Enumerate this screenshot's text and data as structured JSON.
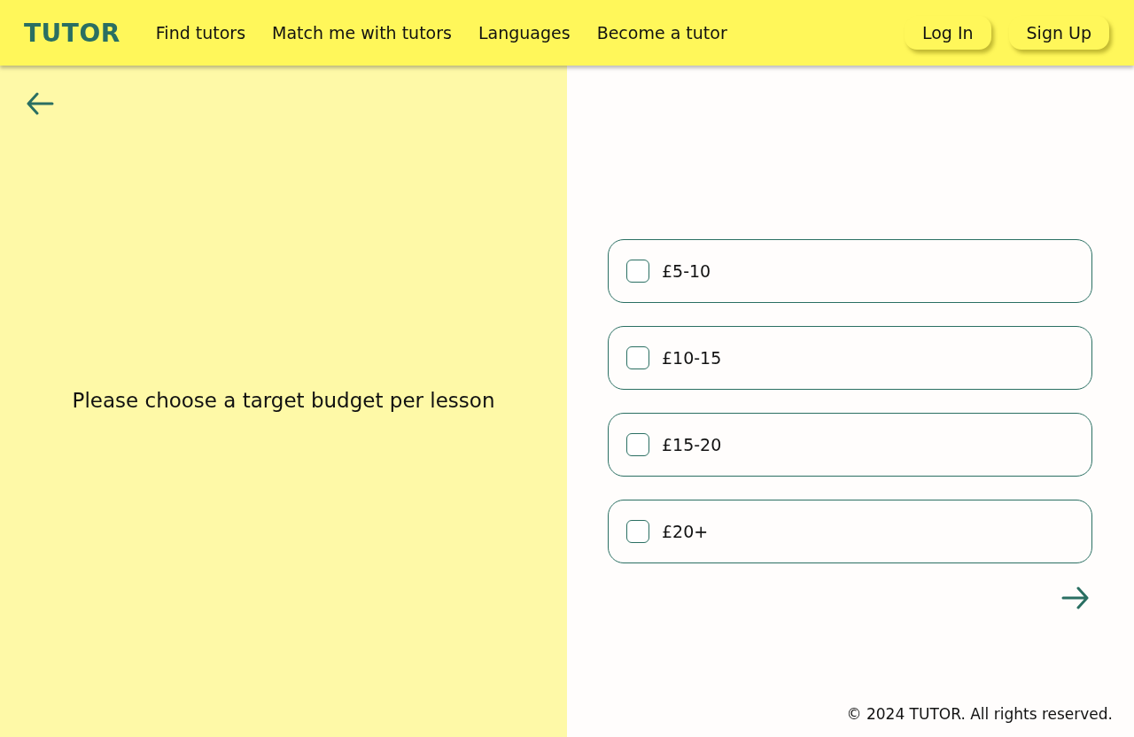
{
  "header": {
    "logo": "TUTOR",
    "nav": [
      {
        "label": "Find tutors"
      },
      {
        "label": "Match me with tutors"
      },
      {
        "label": "Languages"
      },
      {
        "label": "Become a tutor"
      }
    ],
    "buttons": [
      "Log In",
      "Sign Up"
    ]
  },
  "question": "Please choose a target budget per lesson",
  "options": [
    {
      "label": "£5-10",
      "checked": false
    },
    {
      "label": "£10-15",
      "checked": false
    },
    {
      "label": "£15-20",
      "checked": false
    },
    {
      "label": "£20+",
      "checked": false
    }
  ],
  "footer": "© 2024 TUTOR. All rights reserved."
}
